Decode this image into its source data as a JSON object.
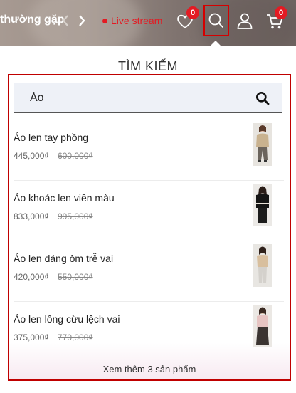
{
  "header": {
    "nav_text": "thường gặp",
    "live_label": "Live stream",
    "wishlist_count": "0",
    "cart_count": "0"
  },
  "search_panel": {
    "title": "TÌM KIẾM",
    "query": "Áo",
    "results": [
      {
        "name": "Áo len tay phồng",
        "price": "445,000₫",
        "old_price": "600,000₫",
        "image": "beige-knit-top-photo"
      },
      {
        "name": "Áo khoác len viền màu",
        "price": "833,000₫",
        "old_price": "995,000₫",
        "image": "black-cardigan-photo"
      },
      {
        "name": "Áo len dáng ôm trễ vai",
        "price": "420,000₫",
        "old_price": "550,000₫",
        "image": "beige-offshoulder-top-photo"
      },
      {
        "name": "Áo len lông cừu lệch vai",
        "price": "375,000₫",
        "old_price": "770,000₫",
        "image": "pink-wool-top-photo"
      }
    ],
    "see_more": "Xem thêm 3 sản phẩm"
  },
  "colors": {
    "accent_red": "#e31b23",
    "highlight_border": "#c00000"
  }
}
